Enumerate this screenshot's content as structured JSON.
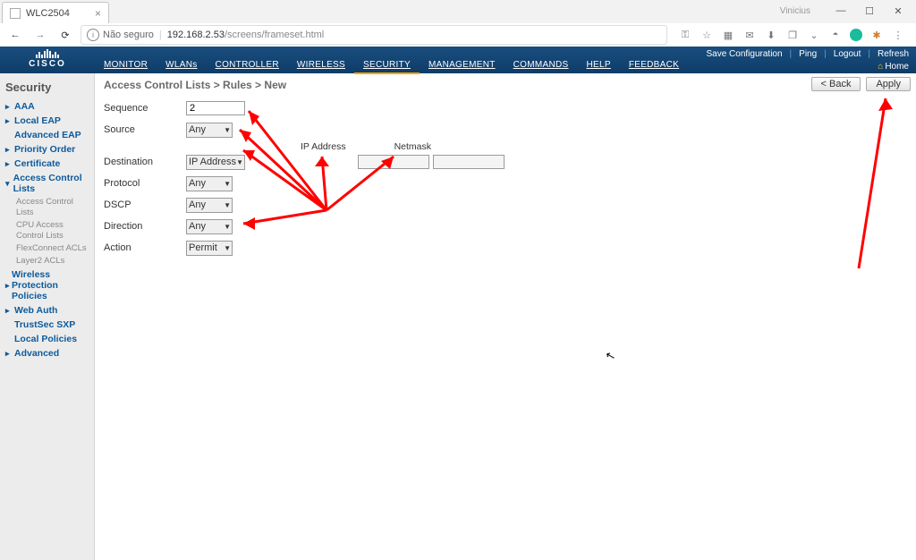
{
  "browser": {
    "tab_title": "WLC2504",
    "user_label": "Vinicius",
    "url_insecure_label": "Não seguro",
    "url_host": "192.168.2.53",
    "url_path": "/screens/frameset.html"
  },
  "header": {
    "brand": "CISCO",
    "nav": {
      "monitor": "MONITOR",
      "wlans": "WLANs",
      "controller": "CONTROLLER",
      "wireless": "WIRELESS",
      "security": "SECURITY",
      "management": "MANAGEMENT",
      "commands": "COMMANDS",
      "help": "HELP",
      "feedback": "FEEDBACK"
    },
    "right": {
      "save": "Save Configuration",
      "ping": "Ping",
      "logout": "Logout",
      "refresh": "Refresh",
      "home": "Home"
    }
  },
  "sidebar": {
    "title": "Security",
    "items": {
      "aaa": "AAA",
      "local_eap": "Local EAP",
      "advanced_eap": "Advanced EAP",
      "priority": "Priority Order",
      "certificate": "Certificate",
      "acl": "Access Control Lists",
      "acl_sub1": "Access Control Lists",
      "acl_sub2": "CPU Access Control Lists",
      "acl_sub3": "FlexConnect ACLs",
      "acl_sub4": "Layer2 ACLs",
      "wpp": "Wireless Protection Policies",
      "webauth": "Web Auth",
      "trustsec": "TrustSec SXP",
      "localpol": "Local Policies",
      "advanced": "Advanced"
    }
  },
  "main": {
    "breadcrumb": "Access Control Lists > Rules > New",
    "back": "< Back",
    "apply": "Apply",
    "labels": {
      "sequence": "Sequence",
      "source": "Source",
      "destination": "Destination",
      "protocol": "Protocol",
      "dscp": "DSCP",
      "direction": "Direction",
      "action": "Action",
      "ip": "IP Address",
      "netmask": "Netmask"
    },
    "values": {
      "sequence": "2",
      "source": "Any",
      "destination": "IP Address",
      "protocol": "Any",
      "dscp": "Any",
      "direction": "Any",
      "action": "Permit"
    }
  }
}
